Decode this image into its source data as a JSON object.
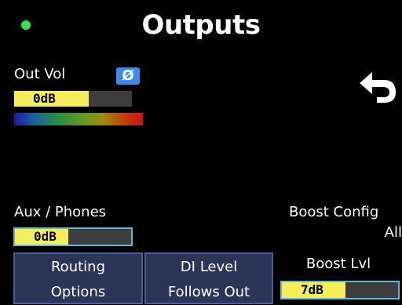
{
  "header": {
    "title": "Outputs",
    "status_color": "#2ee84a"
  },
  "out_vol": {
    "label": "Out Vol",
    "value": "0dB",
    "level_fraction": 0.63,
    "phase_symbol": "Ø"
  },
  "aux": {
    "label": "Aux / Phones",
    "value": "0dB",
    "level_fraction": 0.46
  },
  "boost_config": {
    "label": "Boost Config",
    "value": "All"
  },
  "buttons": {
    "routing_line1": "Routing",
    "routing_line2": "Options",
    "di_line1": "DI Level",
    "di_line2": "Follows Out"
  },
  "boost_lvl": {
    "label": "Boost Lvl",
    "value": "7dB",
    "level_fraction": 0.55
  },
  "icons": {
    "back": "back-arrow-icon",
    "status": "status-dot-icon"
  },
  "colors": {
    "bar_fill": "#f5ee5a",
    "bar_track": "#3d3d3d",
    "button_bg": "#2a3558",
    "accent_border": "#5fb8d8"
  }
}
